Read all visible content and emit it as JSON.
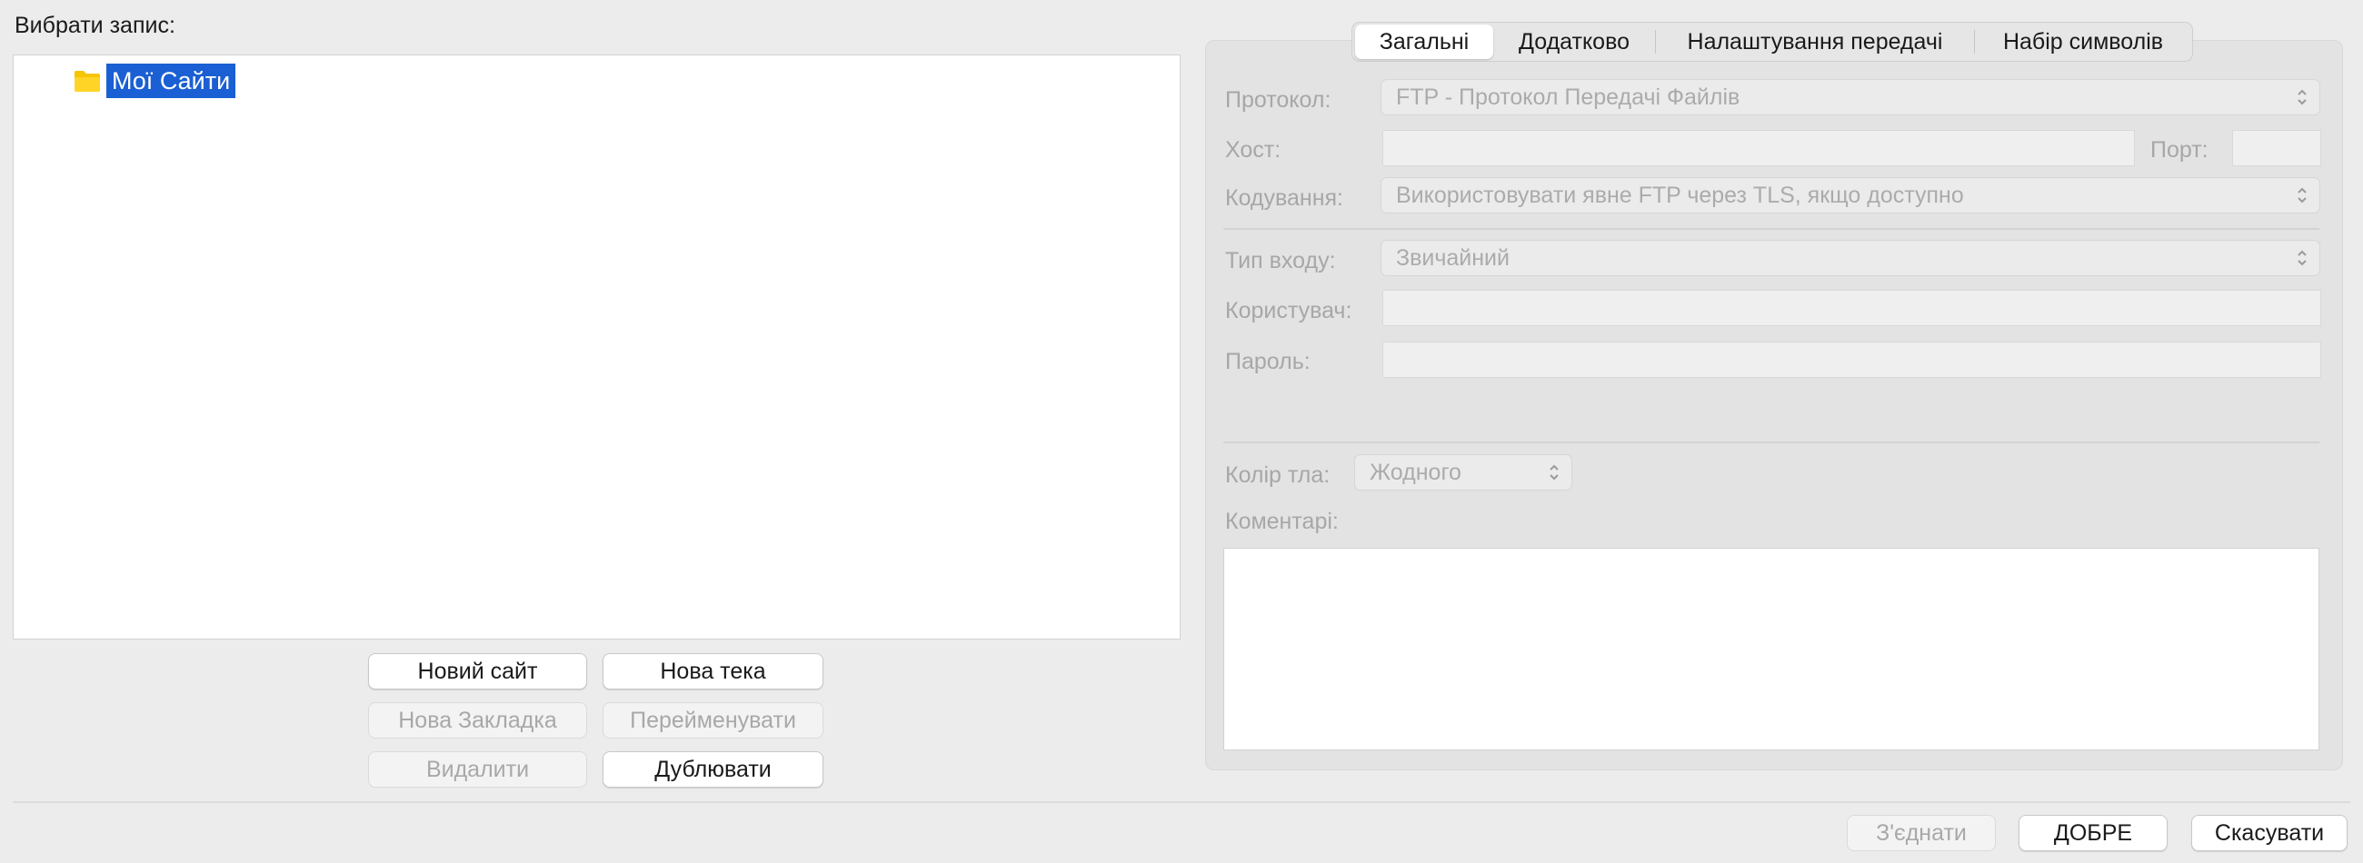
{
  "left": {
    "select_label": "Вибрати запис:",
    "tree": {
      "root_label": "Мої Сайти"
    },
    "buttons": {
      "new_site": "Новий сайт",
      "new_folder": "Нова тека",
      "new_bookmark": "Нова Закладка",
      "rename": "Перейменувати",
      "delete": "Видалити",
      "duplicate": "Дублювати"
    }
  },
  "tabs": [
    "Загальні",
    "Додатково",
    "Налаштування передачі",
    "Набір символів"
  ],
  "form": {
    "protocol_label": "Протокол:",
    "protocol_value": "FTP - Протокол Передачі Файлів",
    "host_label": "Хост:",
    "host_value": "",
    "port_label": "Порт:",
    "port_value": "",
    "encryption_label": "Кодування:",
    "encryption_value": "Використовувати явне FTP через TLS, якщо доступно",
    "logon_label": "Тип входу:",
    "logon_value": "Звичайний",
    "user_label": "Користувач:",
    "user_value": "",
    "password_label": "Пароль:",
    "password_value": "",
    "bgcolor_label": "Колір тла:",
    "bgcolor_value": "Жодного",
    "comments_label": "Коментарі:",
    "comments_value": ""
  },
  "footer": {
    "connect": "З'єднати",
    "ok": "ДОБРЕ",
    "cancel": "Скасувати"
  },
  "colors": {
    "selection": "#1a5fd3",
    "folder": "#f7c400"
  }
}
